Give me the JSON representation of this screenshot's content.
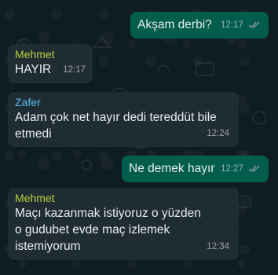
{
  "colors": {
    "outgoing_bubble": "#005c4b",
    "incoming_bubble": "#202c33",
    "text": "#e9edef",
    "mehmet_name": "#b9cf3b",
    "zafer_name": "#53bdeb",
    "tick": "#8696a0"
  },
  "messages": [
    {
      "direction": "out",
      "text": "Akşam derbi?",
      "time": "12:17",
      "status_icon": "double-check-icon"
    },
    {
      "direction": "in",
      "sender": "Mehmet",
      "text": "HAYIR",
      "time": "12:17"
    },
    {
      "direction": "in",
      "sender": "Zafer",
      "text": "Adam çok net hayır dedi tereddüt bile\netmedi",
      "time": "12:24"
    },
    {
      "direction": "out",
      "text": "Ne demek hayır",
      "time": "12:27",
      "status_icon": "double-check-icon"
    },
    {
      "direction": "in",
      "sender": "Mehmet",
      "text": "Maçı kazanmak istiyoruz o yüzden\no gudubet evde maç izlemek\nistemiyorum",
      "time": "12:34"
    }
  ]
}
